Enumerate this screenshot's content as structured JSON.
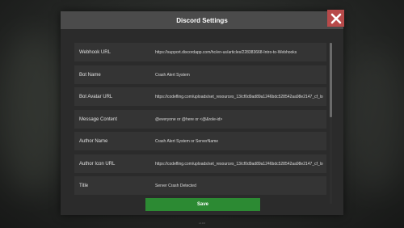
{
  "dialog": {
    "title": "Discord Settings",
    "close_icon": "close-x-icon",
    "save_label": "Save"
  },
  "settings": [
    {
      "label": "Webhook URL",
      "value": "https://support.discordapp.com/hc/en-us/articles/228383668-Intro-to-Webhooks"
    },
    {
      "label": "Bot Name",
      "value": "Crash Alert System"
    },
    {
      "label": "Bot Avatar URL",
      "value": "https://codefling.com/uploads/set_resources_13/cf0d9ad89a1246bdc528542aa98e2147_cf_lo"
    },
    {
      "label": "Message Content",
      "value": "@everyone or @here or <@&role-id>"
    },
    {
      "label": "Author Name",
      "value": "Crash Alert System or ServerName"
    },
    {
      "label": "Author Icon URL",
      "value": "https://codefling.com/uploads/set_resources_13/cf0d9ad89a1246bdc528542aa98e2147_cf_lo"
    },
    {
      "label": "Title",
      "value": "Server Crash Detected"
    }
  ],
  "footer": {
    "note": "v1.0.0"
  },
  "colors": {
    "header": "#4b4b4b",
    "close": "#b84a4a",
    "save": "#2c8a33",
    "row": "#343434"
  }
}
